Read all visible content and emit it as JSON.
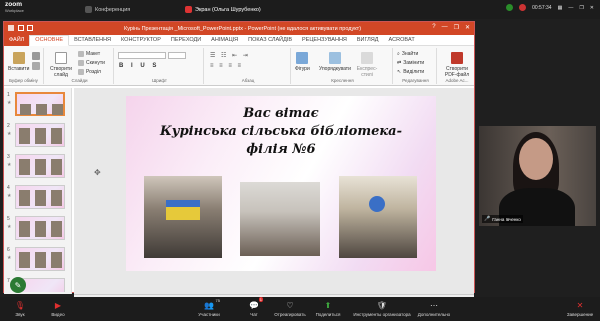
{
  "zoom": {
    "logo_line1": "zoom",
    "logo_line2": "Workplace",
    "tabs": [
      {
        "label": "Конференция",
        "active": false
      },
      {
        "label": "Экран (Ольга Шурубенко)",
        "active": true
      }
    ],
    "clock": "00:57:34"
  },
  "ppt": {
    "title": "Курінь Презентація _Microsoft_PowerPoint.pptx - PowerPoint (не вдалося активувати продукт)",
    "window_controls": [
      "?",
      "—",
      "❐",
      "✕"
    ],
    "tabs": [
      "ФАЙЛ",
      "ОСНОВНЕ",
      "ВСТАВЛЕННЯ",
      "КОНСТРУКТОР",
      "ПЕРЕХОДИ",
      "АНІМАЦІЯ",
      "ПОКАЗ СЛАЙДІВ",
      "РЕЦЕНЗУВАННЯ",
      "ВИГЛЯД",
      "ACROBAT"
    ],
    "ribbon": {
      "paste": "Вставити",
      "clipboard_group": "Буфер обміну",
      "new_slide": "Створити слайд",
      "layout": "Макет",
      "reset": "Скинути",
      "section": "Розділ",
      "slides_group": "Слайди",
      "font_group": "Шрифт",
      "paragraph_group": "Абзац",
      "shapes": "Фігури",
      "arrange": "Упорядкувати",
      "quick_styles": "Експрес-стилі",
      "drawing_group": "Креслення",
      "find": "Знайти",
      "replace": "Замінити",
      "select": "Виділити",
      "editing_group": "Редагування",
      "create_pdf": "Створити PDF-файл",
      "adobe_group": "Adobe Ac..."
    },
    "slide_numbers": [
      "1",
      "2",
      "3",
      "4",
      "5",
      "6",
      "7"
    ],
    "slide": {
      "line1": "Вас вітає",
      "line2": "Курінська сільська бібліотека-",
      "line3": "філія №6"
    },
    "notes_placeholder": "Нотатки до слайда"
  },
  "video": {
    "name": "Ганна Івченко"
  },
  "toolbar": {
    "audio": "Звук",
    "video": "Видео",
    "participants": "Участники",
    "participants_count": "75",
    "chat": "Чат",
    "chat_badge": "1",
    "react": "Отреагировать",
    "share": "Поделиться",
    "host_tools": "Инструменты организатора",
    "more": "Дополнительно",
    "end": "Завершение"
  },
  "colors": {
    "ppt_accent": "#d24726",
    "zoom_bg": "#1c1c1c",
    "end_red": "#e02f2f",
    "slide_pink": "#f5d4ec"
  }
}
